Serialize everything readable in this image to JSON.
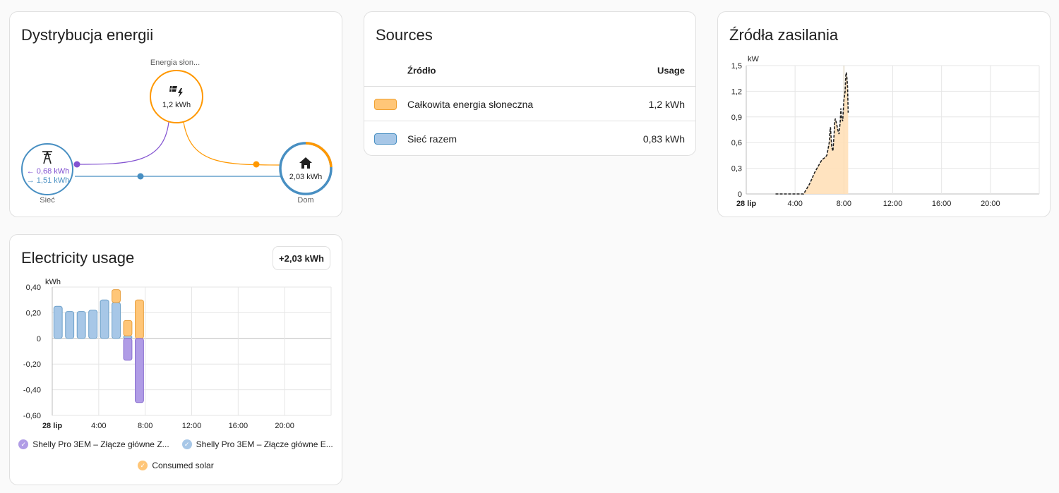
{
  "distribution": {
    "title": "Dystrybucja energii",
    "solar_label": "Energia słon...",
    "solar_value": "1,2 kWh",
    "grid_label": "Sieć",
    "grid_in": "← 0,68 kWh",
    "grid_out": "→ 1,51 kWh",
    "home_label": "Dom",
    "home_value": "2,03 kWh",
    "colors": {
      "solar": "#ff9800",
      "grid": "#488fc2",
      "return": "#8353d1"
    }
  },
  "sources": {
    "title": "Sources",
    "col_source": "Źródło",
    "col_usage": "Usage",
    "rows": [
      {
        "name": "Całkowita energia słoneczna",
        "usage": "1,2 kWh",
        "color": "#ffc678"
      },
      {
        "name": "Sieć razem",
        "usage": "0,83 kWh",
        "color": "#a7c7e7"
      }
    ]
  },
  "power_sources": {
    "title": "Źródła zasilania",
    "chart_data": {
      "type": "area",
      "title": "Źródła zasilania",
      "ylabel": "kW",
      "ylim": [
        0,
        1.5
      ],
      "yticks": [
        "0",
        "0,3",
        "0,6",
        "0,9",
        "1,2",
        "1,5"
      ],
      "xticks": [
        "28 lip",
        "4:00",
        "8:00",
        "12:00",
        "16:00",
        "20:00"
      ],
      "x_hours": [
        2.4,
        3.6,
        4.3,
        4.7,
        5.2,
        5.6,
        6.0,
        6.2,
        6.4,
        6.6,
        6.8,
        6.85,
        6.9,
        7.0,
        7.1,
        7.2,
        7.25,
        7.3,
        7.4,
        7.5,
        7.6,
        7.7,
        7.75,
        7.8,
        7.9,
        8.0,
        8.1,
        8.15,
        8.2,
        8.25,
        8.3,
        8.35
      ],
      "y_kw": [
        0.0,
        0.0,
        0.0,
        0.0,
        0.12,
        0.25,
        0.35,
        0.4,
        0.42,
        0.45,
        0.6,
        0.72,
        0.78,
        0.55,
        0.5,
        0.7,
        0.85,
        0.88,
        0.82,
        0.75,
        0.7,
        0.85,
        1.0,
        0.9,
        0.85,
        1.1,
        1.2,
        1.38,
        1.42,
        1.35,
        1.25,
        0.95
      ]
    }
  },
  "usage": {
    "title": "Electricity usage",
    "total": "+2,03 kWh",
    "legend": [
      "Shelly Pro 3EM – Złącze główne Z...",
      "Shelly Pro 3EM – Złącze główne E...",
      "Consumed solar"
    ],
    "chart_data": {
      "type": "bar",
      "ylabel": "kWh",
      "ylim": [
        -0.6,
        0.4
      ],
      "yticks": [
        "0,40",
        "0,20",
        "0",
        "-0,20",
        "-0,40",
        "-0,60"
      ],
      "xticks": [
        "28 lip",
        "4:00",
        "8:00",
        "12:00",
        "16:00",
        "20:00"
      ],
      "hours": [
        0,
        1,
        2,
        3,
        4,
        5,
        6,
        7
      ],
      "series": [
        {
          "name": "Shelly Pro 3EM – Złącze główne E...",
          "color": "#a7c7e7",
          "values": [
            0.25,
            0.21,
            0.21,
            0.22,
            0.3,
            0.28,
            0.02,
            0.0
          ]
        },
        {
          "name": "Consumed solar",
          "color": "#ffc678",
          "values": [
            0.0,
            0.0,
            0.0,
            0.0,
            0.0,
            0.1,
            0.12,
            0.3
          ]
        },
        {
          "name": "Shelly Pro 3EM – Złącze główne Z...",
          "color": "#b09ce6",
          "values": [
            0.0,
            0.0,
            0.0,
            0.0,
            0.0,
            0.0,
            -0.17,
            -0.5
          ]
        }
      ]
    }
  }
}
